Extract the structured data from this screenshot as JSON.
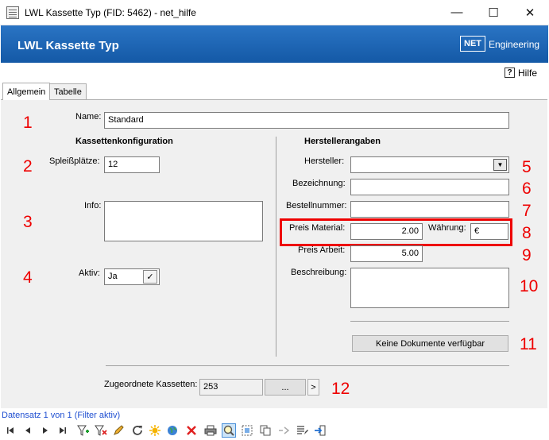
{
  "window": {
    "title": "LWL Kassette Typ (FID: 5462) - net_hilfe",
    "minimize_glyph": "—",
    "maximize_glyph": "☐",
    "close_glyph": "✕"
  },
  "header": {
    "title": "LWL Kassette Typ",
    "logo_box": "NET",
    "logo_text": "Engineering"
  },
  "help": {
    "icon_glyph": "?",
    "label": "Hilfe"
  },
  "tabs": [
    {
      "label": "Allgemein",
      "active": true
    },
    {
      "label": "Tabelle",
      "active": false
    }
  ],
  "form": {
    "name_label": "Name:",
    "name_value": "Standard",
    "left_section": "Kassettenkonfiguration",
    "right_section": "Herstellerangaben",
    "spleiss_label": "Spleißplätze:",
    "spleiss_value": "12",
    "info_label": "Info:",
    "info_value": "",
    "aktiv_label": "Aktiv:",
    "aktiv_value": "Ja",
    "aktiv_check": "✓",
    "hersteller_label": "Hersteller:",
    "hersteller_value": "",
    "dropdown_glyph": "▼",
    "bezeichnung_label": "Bezeichnung:",
    "bezeichnung_value": "",
    "bestellnummer_label": "Bestellnummer:",
    "bestellnummer_value": "",
    "preis_material_label": "Preis Material:",
    "preis_material_value": "2.00",
    "waehrung_label": "Währung:",
    "waehrung_value": "€",
    "preis_arbeit_label": "Preis Arbeit:",
    "preis_arbeit_value": "5.00",
    "beschreibung_label": "Beschreibung:",
    "beschreibung_value": "",
    "dokumente_button": "Keine Dokumente verfügbar",
    "kassetten_label": "Zugeordnete Kassetten:",
    "kassetten_value": "253",
    "kassetten_dots": "...",
    "kassetten_next": ">"
  },
  "annotations": [
    "1",
    "2",
    "3",
    "4",
    "5",
    "6",
    "7",
    "8",
    "9",
    "10",
    "11",
    "12"
  ],
  "status": {
    "text": "Datensatz 1 von 1 (Filter aktiv)"
  },
  "accent_colors": {
    "header_blue": "#1a63b3",
    "annotation_red": "#e00000",
    "status_blue": "#1f4fd1"
  }
}
